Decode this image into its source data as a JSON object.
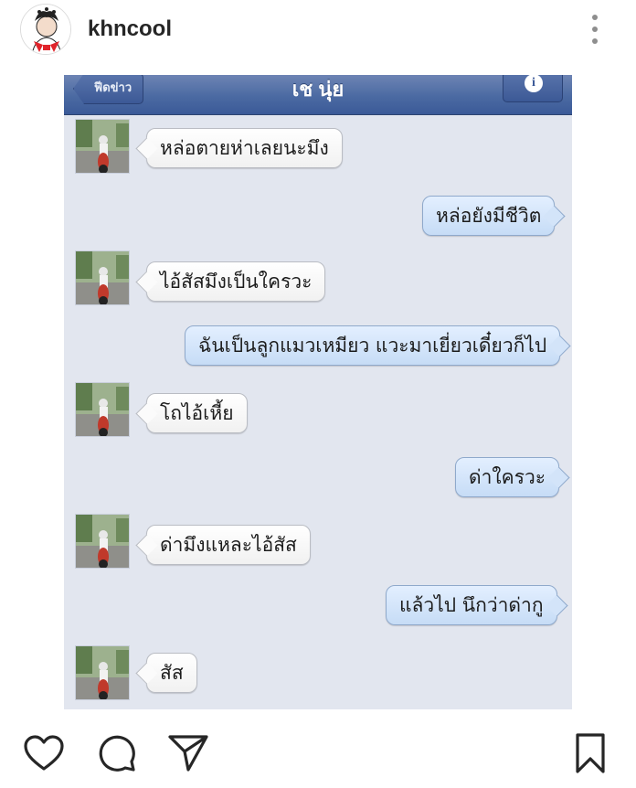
{
  "post": {
    "username": "khncool"
  },
  "chat": {
    "nav_back": "ฟีดข่าว",
    "nav_title": "เช นุ่ย",
    "nav_info": "i",
    "messages": [
      {
        "side": "in",
        "text": "หล่อตายห่าเลยนะมึง"
      },
      {
        "side": "out",
        "text": "หล่อยังมีชีวิต"
      },
      {
        "side": "in",
        "text": "ไอ้สัสมึงเป็นใครวะ"
      },
      {
        "side": "out",
        "text": "ฉันเป็นลูกแมวเหมียว แวะมาเยี่ยวเดี๋ยวก็ไป"
      },
      {
        "side": "in",
        "text": "โถไอ้เหี้ย"
      },
      {
        "side": "out",
        "text": "ด่าใครวะ"
      },
      {
        "side": "in",
        "text": "ด่ามึงแหละไอ้สัส"
      },
      {
        "side": "out",
        "text": "แล้วไป นึกว่าด่ากู"
      },
      {
        "side": "in",
        "text": "สัส"
      }
    ]
  },
  "actions": {
    "icons": [
      "heart-icon",
      "comment-icon",
      "share-icon",
      "bookmark-icon"
    ]
  },
  "colors": {
    "nav_bar": "#4b6aa2",
    "chat_bg": "#e2e6ef",
    "incoming_bubble": "#ffffff",
    "outgoing_bubble": "#c6dcf6"
  }
}
